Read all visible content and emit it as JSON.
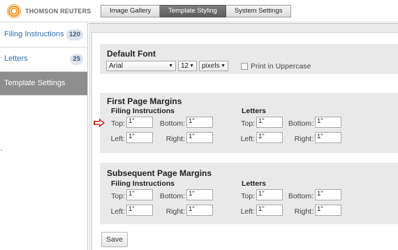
{
  "brand": {
    "name": "THOMSON REUTERS",
    "logo_icon": "thomson-reuters-logo"
  },
  "tabs": [
    {
      "label": "Image Gallery",
      "active": false
    },
    {
      "label": "Template Styling",
      "active": true
    },
    {
      "label": "System Settings",
      "active": false
    }
  ],
  "sidebar": {
    "items": [
      {
        "label": "Filing Instructions",
        "count": "120"
      },
      {
        "label": "Letters",
        "count": "25"
      },
      {
        "label": "Template Settings",
        "active": true
      }
    ]
  },
  "default_font": {
    "title": "Default Font",
    "font_family": "Arial",
    "font_size": "12",
    "unit": "pixels",
    "uppercase_label": "Print in Uppercase",
    "uppercase_checked": false
  },
  "first_page_margins": {
    "title": "First Page Margins",
    "filing": {
      "title": "Filing Instructions",
      "top_label": "Top:",
      "top": "1\"",
      "bottom_label": "Bottom:",
      "bottom": "1\"",
      "left_label": "Left:",
      "left": "1\"",
      "right_label": "Right:",
      "right": "1\""
    },
    "letters": {
      "title": "Letters",
      "top_label": "Top:",
      "top": "1\"",
      "bottom_label": "Bottom:",
      "bottom": "1\"",
      "left_label": "Left:",
      "left": "1\"",
      "right_label": "Right:",
      "right": "1\""
    }
  },
  "subsequent_page_margins": {
    "title": "Subsequent Page Margins",
    "filing": {
      "title": "Filing Instructions",
      "top_label": "Top:",
      "top": "1\"",
      "bottom_label": "Bottom:",
      "bottom": "1\"",
      "left_label": "Left:",
      "left": "1\"",
      "right_label": "Right:",
      "right": "1\""
    },
    "letters": {
      "title": "Letters",
      "top_label": "Top:",
      "top": "1\"",
      "bottom_label": "Bottom:",
      "bottom": "1\"",
      "left_label": "Left:",
      "left": "1\"",
      "right_label": "Right:",
      "right": "1\""
    }
  },
  "actions": {
    "save_label": "Save"
  },
  "colors": {
    "accent_link": "#2b72b8",
    "active_tab": "#5c5c5c",
    "active_sidebar": "#8e8e8e",
    "pointer_arrow": "#e02020"
  }
}
